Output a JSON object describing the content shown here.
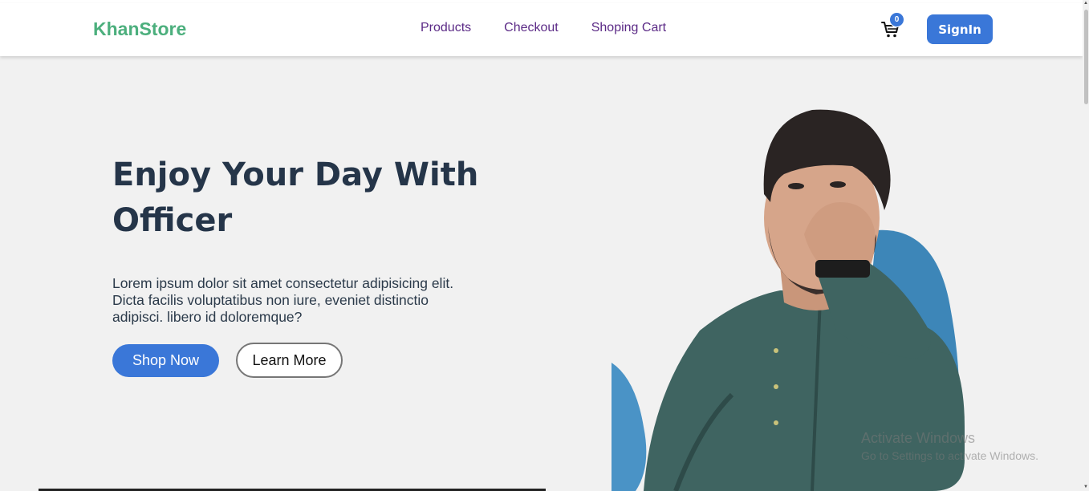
{
  "brand": {
    "name": "KhanStore",
    "color": "#4caf7d"
  },
  "nav": {
    "links": [
      {
        "label": "Products"
      },
      {
        "label": "Checkout"
      },
      {
        "label": "Shoping Cart"
      }
    ]
  },
  "cart": {
    "icon": "cart-icon",
    "count": "0"
  },
  "signin": {
    "label": "SignIn"
  },
  "hero": {
    "title": "Enjoy Your Day With Officer",
    "text": "Lorem ipsum dolor sit amet consectetur adipisicing elit. Dicta facilis voluptatibus non iure, eveniet distinctio adipisci. libero id doloremque?",
    "primary_button": "Shop Now",
    "secondary_button": "Learn More",
    "image": "smiling-man-portrait"
  },
  "watermark": {
    "title": "Activate Windows",
    "subtitle": "Go to Settings to activate Windows."
  },
  "colors": {
    "accent": "#3a77d8",
    "nav_link": "#5b2a86",
    "title": "#253549",
    "background": "#f1f1f1"
  }
}
